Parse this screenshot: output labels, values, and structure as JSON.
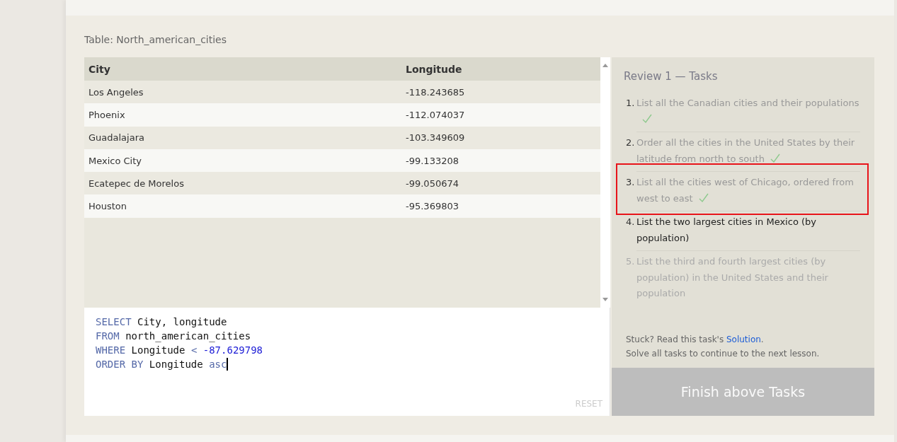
{
  "table_caption": "Table: North_american_cities",
  "table": {
    "columns": [
      "City",
      "Longitude"
    ],
    "rows": [
      [
        "Los Angeles",
        "-118.243685"
      ],
      [
        "Phoenix",
        "-112.074037"
      ],
      [
        "Guadalajara",
        "-103.349609"
      ],
      [
        "Mexico City",
        "-99.133208"
      ],
      [
        "Ecatepec de Morelos",
        "-99.050674"
      ],
      [
        "Houston",
        "-95.369803"
      ]
    ]
  },
  "editor": {
    "lines": [
      [
        {
          "kind": "keyword",
          "text": "SELECT"
        },
        {
          "kind": "plain",
          "text": " City, longitude"
        }
      ],
      [
        {
          "kind": "keyword",
          "text": "FROM"
        },
        {
          "kind": "plain",
          "text": " north_american_cities"
        }
      ],
      [
        {
          "kind": "keyword",
          "text": "WHERE"
        },
        {
          "kind": "plain",
          "text": " Longitude "
        },
        {
          "kind": "keyword",
          "text": "< "
        },
        {
          "kind": "number",
          "text": "-87.629798"
        }
      ],
      [
        {
          "kind": "keyword",
          "text": "ORDER BY"
        },
        {
          "kind": "plain",
          "text": " Longitude "
        },
        {
          "kind": "keyword",
          "text": "asc"
        }
      ]
    ],
    "reset": "RESET"
  },
  "tasks_panel": {
    "title": "Review 1 — Tasks",
    "tasks": [
      {
        "number": "1.",
        "text": "List all the Canadian cities and their populations",
        "done": true,
        "current": false,
        "highlighted": false
      },
      {
        "number": "2.",
        "text": "Order all the cities in the United States by their latitude from north to south",
        "done": true,
        "current": false,
        "highlighted": false
      },
      {
        "number": "3.",
        "text": "List all the cities west of Chicago, ordered from west to east",
        "done": true,
        "current": false,
        "highlighted": true
      },
      {
        "number": "4.",
        "text": "List the two largest cities in Mexico (by population)",
        "done": false,
        "current": true,
        "highlighted": false
      },
      {
        "number": "5.",
        "text": "List the third and fourth largest cities (by population) in the United States and their population",
        "done": false,
        "current": false,
        "highlighted": false
      }
    ],
    "hint_before": "Stuck? Read this task's ",
    "hint_link": "Solution",
    "hint_after": ".",
    "note": "Solve all tasks to continue to the next lesson.",
    "finish_button": "Finish above Tasks"
  }
}
